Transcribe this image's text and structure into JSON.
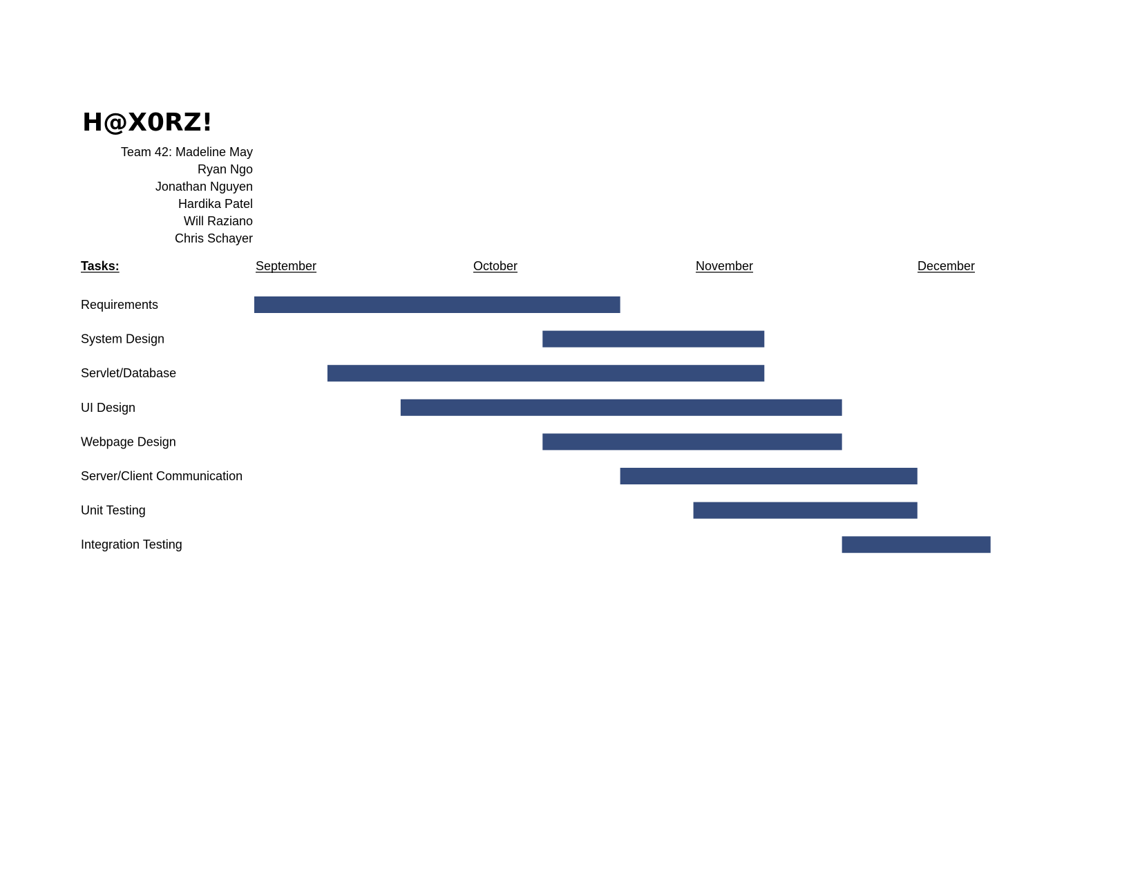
{
  "title": "H@X0RZ!",
  "team": {
    "lines": [
      "Team 42: Madeline May",
      "Ryan Ngo",
      "Jonathan Nguyen",
      "Hardika Patel",
      "Will Raziano",
      "Chris Schayer"
    ]
  },
  "chart_data": {
    "type": "gantt",
    "tasks_header": "Tasks:",
    "months": [
      "September",
      "October",
      "November",
      "December"
    ],
    "bar_color": "#354c7c",
    "grid": false,
    "tasks": [
      {
        "name": "Requirements",
        "start": 0.0,
        "end": 1.65
      },
      {
        "name": "System Design",
        "start": 1.3,
        "end": 2.3
      },
      {
        "name": "Servlet/Database",
        "start": 0.33,
        "end": 2.3
      },
      {
        "name": "UI Design",
        "start": 0.66,
        "end": 2.65
      },
      {
        "name": "Webpage Design",
        "start": 1.3,
        "end": 2.65
      },
      {
        "name": "Server/Client Communication",
        "start": 1.65,
        "end": 2.99
      },
      {
        "name": "Unit Testing",
        "start": 1.98,
        "end": 2.99
      },
      {
        "name": "Integration Testing",
        "start": 2.65,
        "end": 3.32
      }
    ]
  }
}
